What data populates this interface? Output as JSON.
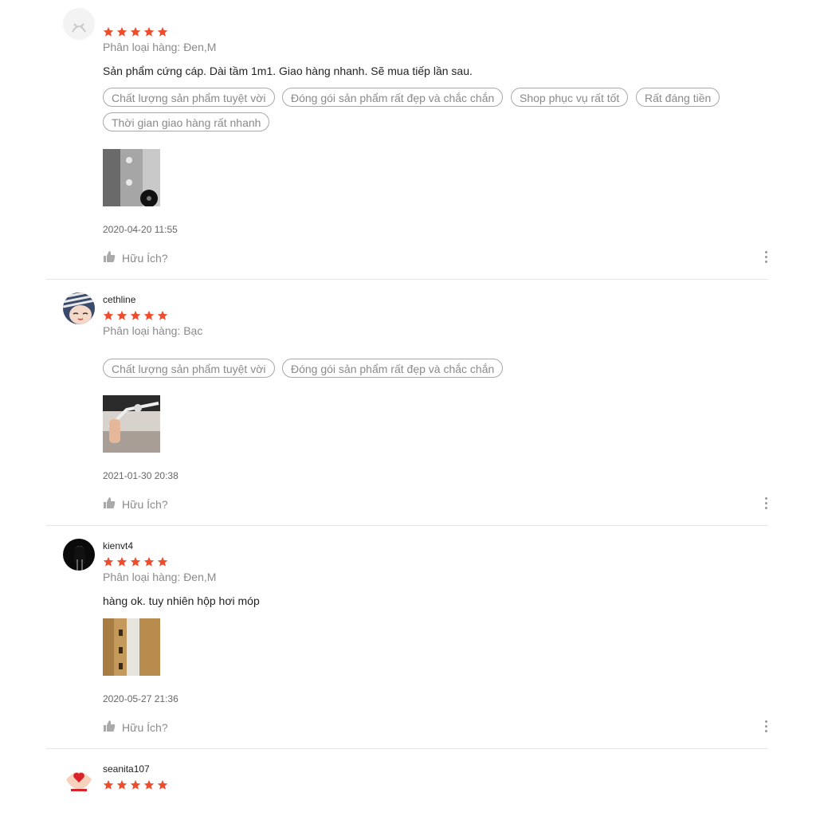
{
  "reviews": [
    {
      "username": "",
      "rating": 5,
      "variant": "Phân loại hàng: Đen,M",
      "comment": "Sản phẩm cứng cáp. Dài tầm 1m1. Giao hàng nhanh. Sẽ mua tiếp lần sau.",
      "tags": [
        "Chất lượng sản phẩm tuyệt vời",
        "Đóng gói sản phẩm rất đẹp và chắc chắn",
        "Shop phục vụ rất tốt",
        "Rất đáng tiền",
        "Thời gian giao hàng rất nhanh"
      ],
      "date": "2020-04-20 11:55",
      "helpful_label": "Hữu Ích?"
    },
    {
      "username": "cethline",
      "rating": 5,
      "variant": "Phân loại hàng: Bạc",
      "comment": "",
      "tags": [
        "Chất lượng sản phẩm tuyệt vời",
        "Đóng gói sản phẩm rất đẹp và chắc chắn"
      ],
      "date": "2021-01-30 20:38",
      "helpful_label": "Hữu Ích?"
    },
    {
      "username": "kienvt4",
      "rating": 5,
      "variant": "Phân loại hàng: Đen,M",
      "comment": "hàng ok. tuy nhiên hộp hơi móp",
      "tags": [],
      "date": "2020-05-27 21:36",
      "helpful_label": "Hữu Ích?"
    },
    {
      "username": "seanita107",
      "rating": 5
    }
  ],
  "colors": {
    "star": "#ee4d2d",
    "tag_border": "#a8a8a8",
    "muted_text": "#8a8a8a",
    "divider": "#e6e6e6"
  },
  "icons": {
    "helpful": "thumbs-up-icon",
    "more": "more-vertical-icon",
    "star": "star-icon"
  }
}
